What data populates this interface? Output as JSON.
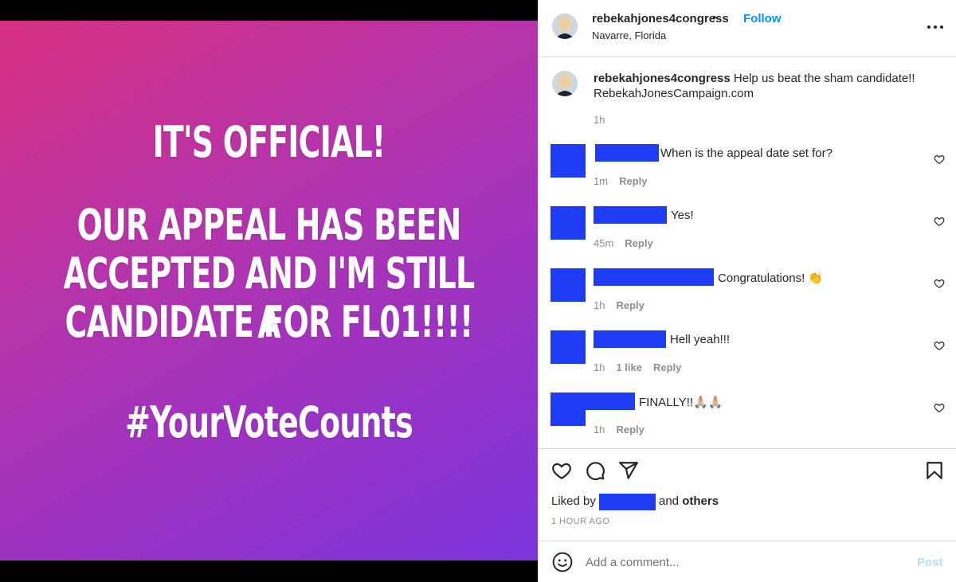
{
  "post_image": {
    "lines": [
      "IT'S OFFICIAL!",
      "OUR APPEAL HAS BEEN",
      "ACCEPTED AND I'M STILL A",
      "CANDIDATE FOR FL01!!!!",
      "#YourVoteCounts"
    ]
  },
  "header": {
    "username": "rebekahjones4congress",
    "separator": "•",
    "follow_label": "Follow",
    "location": "Navarre, Florida"
  },
  "caption": {
    "username": "rebekahjones4congress",
    "text": "Help us beat the sham candidate!! RebekahJonesCampaign.com",
    "time": "1h"
  },
  "comments": [
    {
      "text": "When is the appeal date set for?",
      "time": "1m",
      "likes": "",
      "reply": "Reply"
    },
    {
      "text": "Yes!",
      "time": "45m",
      "likes": "",
      "reply": "Reply"
    },
    {
      "text": "Congratulations! 👏",
      "time": "1h",
      "likes": "",
      "reply": "Reply"
    },
    {
      "text": "Hell yeah!!!",
      "time": "1h",
      "likes": "1 like",
      "reply": "Reply"
    },
    {
      "text": "FINALLY!!🙏🏼🙏🏼",
      "time": "1h",
      "likes": "",
      "reply": "Reply"
    }
  ],
  "likes": {
    "prefix": "Liked by",
    "and": "and",
    "others": "others"
  },
  "timestamp": "1 HOUR AGO",
  "comment_box": {
    "placeholder": "Add a comment...",
    "post_label": "Post"
  },
  "colors": {
    "accent": "#0095f6",
    "redaction": "#1f3cf5",
    "gradient_start": "#d7307f",
    "gradient_end": "#7a35dc"
  },
  "icons": [
    "heart-icon",
    "comment-icon",
    "share-icon",
    "bookmark-icon",
    "emoji-icon",
    "more-icon"
  ]
}
